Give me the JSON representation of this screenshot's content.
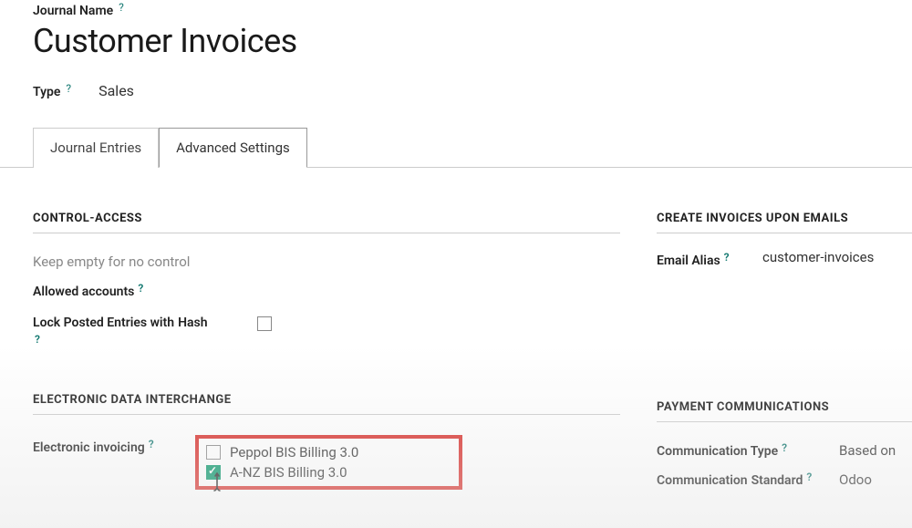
{
  "header": {
    "journal_name_label": "Journal Name",
    "journal_title": "Customer Invoices",
    "type_label": "Type",
    "type_value": "Sales"
  },
  "tabs": {
    "journal_entries": "Journal Entries",
    "advanced_settings": "Advanced Settings"
  },
  "control_access": {
    "title": "CONTROL-ACCESS",
    "keep_empty": "Keep empty for no control",
    "allowed_accounts_label": "Allowed accounts",
    "lock_label_1": "Lock Posted Entries with",
    "lock_label_2": "Hash"
  },
  "edi": {
    "title": "ELECTRONIC DATA INTERCHANGE",
    "label": "Electronic invoicing",
    "options": [
      {
        "label": "Peppol BIS Billing 3.0",
        "checked": false
      },
      {
        "label": "A-NZ BIS Billing 3.0",
        "checked": true
      }
    ]
  },
  "emails": {
    "title": "CREATE INVOICES UPON EMAILS",
    "alias_label": "Email Alias",
    "alias_value": "customer-invoices"
  },
  "payment": {
    "title": "PAYMENT COMMUNICATIONS",
    "comm_type_label": "Communication Type",
    "comm_type_value": "Based on",
    "comm_std_label_1": "Communication",
    "comm_std_label_2": "Standard",
    "comm_std_value": "Odoo"
  }
}
